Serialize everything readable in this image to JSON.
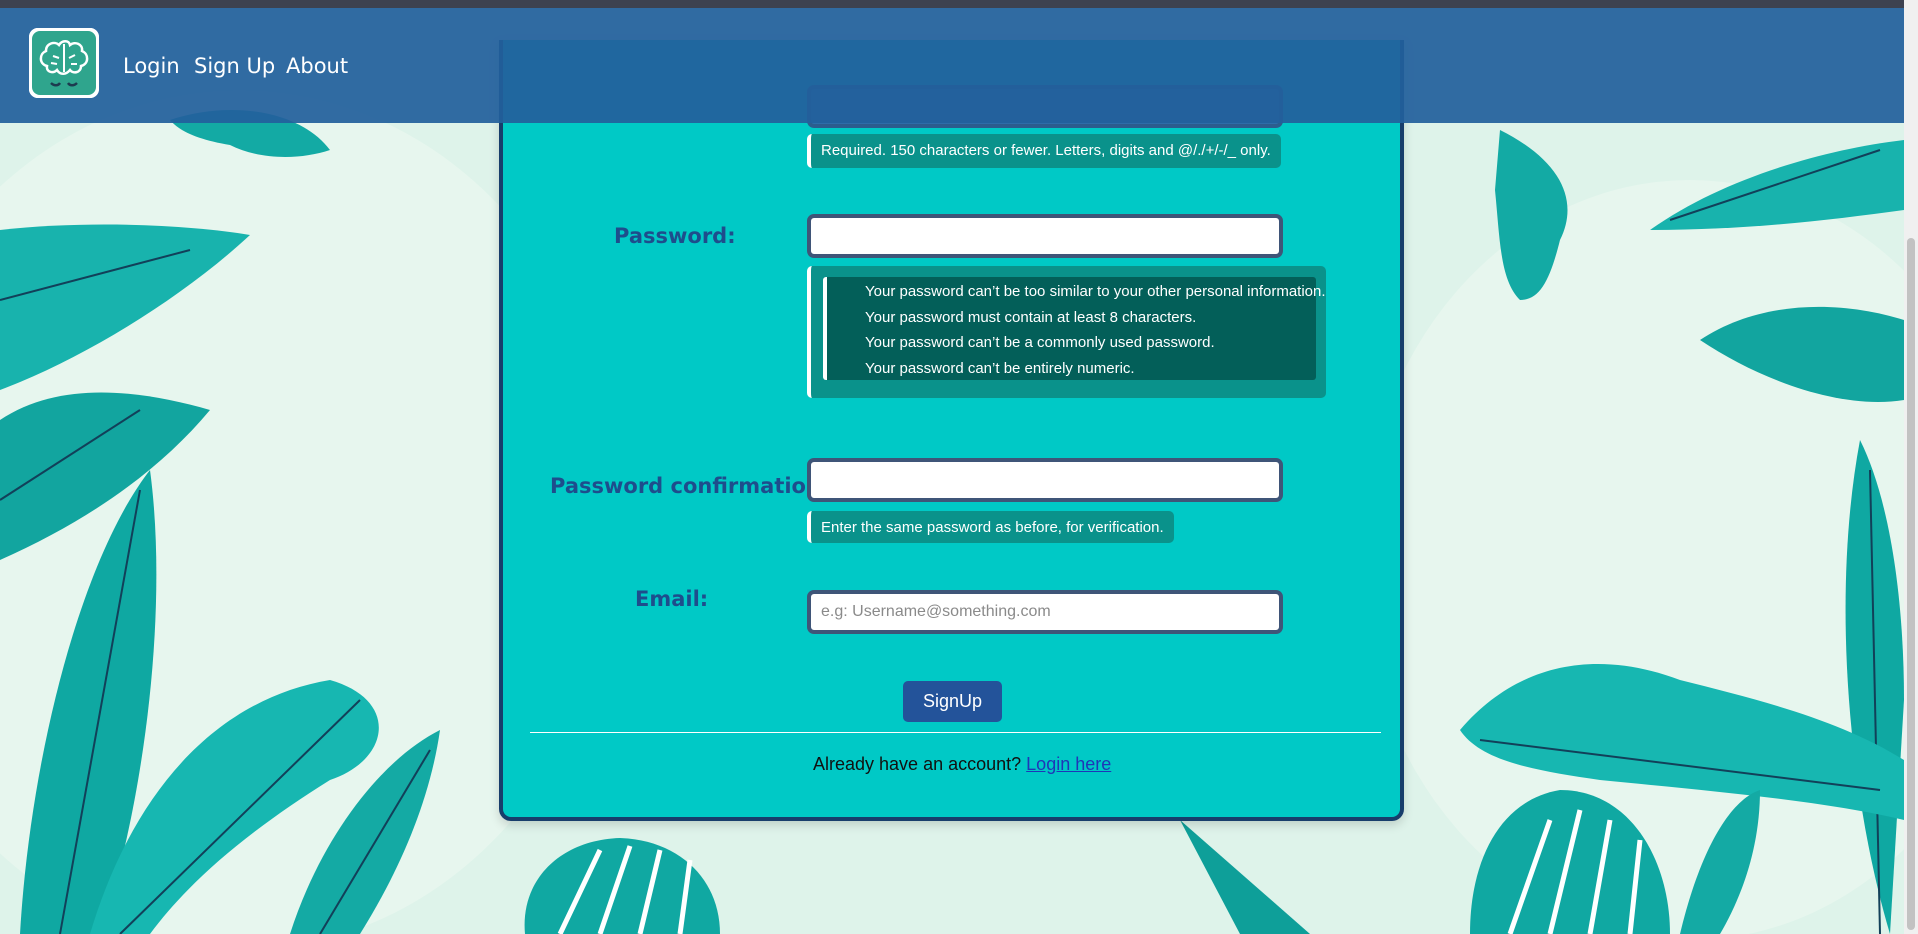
{
  "nav": {
    "links": [
      "Login",
      "Sign Up",
      "About"
    ]
  },
  "form": {
    "username_help": "Required. 150 characters or fewer. Letters, digits and @/./+/-/_ only.",
    "password_label": "Password:",
    "password_help": [
      "Your password can’t be too similar to your other personal information.",
      "Your password must contain at least 8 characters.",
      "Your password can’t be a commonly used password.",
      "Your password can’t be entirely numeric."
    ],
    "password_confirmation_label": "Password confirmation:",
    "password_confirmation_help": "Enter the same password as before, for verification.",
    "email_label": "Email:",
    "email_placeholder": "e.g: Username@something.com",
    "submit_label": "SignUp"
  },
  "footer": {
    "prompt": "Already have an account?",
    "link": "Login here"
  },
  "colors": {
    "navbar": "#22609c",
    "panel": "#00c9c6",
    "panel_border": "#173d6b",
    "help_bg": "#0a928b",
    "button": "#23539a",
    "label": "#1e4d8c"
  }
}
